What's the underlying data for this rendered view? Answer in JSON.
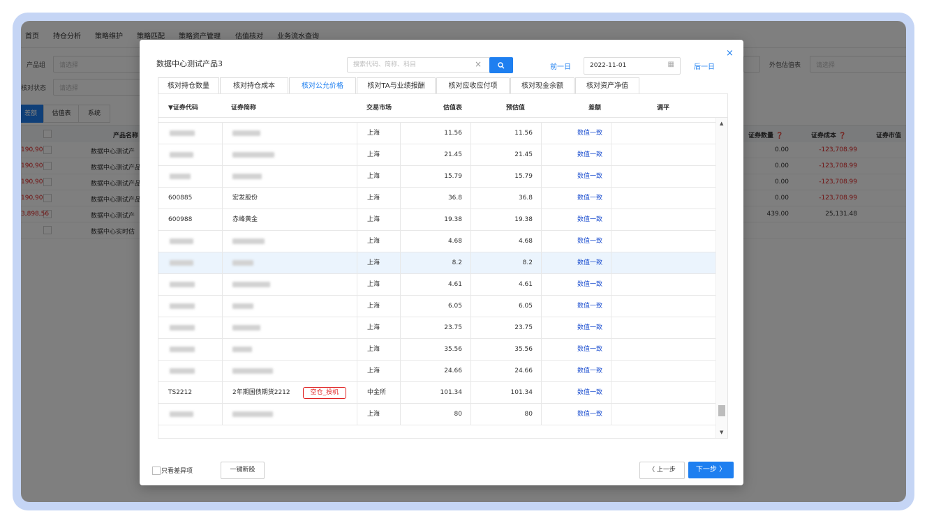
{
  "nav": {
    "items": [
      "首页",
      "持仓分析",
      "策略维护",
      "策略匹配",
      "策略资产管理",
      "估值核对",
      "业务流水查询"
    ],
    "active_index": 5
  },
  "filters": {
    "product_group_label": "产品组",
    "product_group_placeholder": "请选择",
    "check_status_label": "核对状态",
    "check_status_placeholder": "请选择",
    "outsource_label": "外包估值表",
    "outsource_placeholder": "请选择"
  },
  "subtabs": [
    "差额",
    "估值表",
    "系统"
  ],
  "bg_table": {
    "headers": {
      "product_name": "产品名称",
      "sec_qty": "证券数量 ❓",
      "sec_cost": "证券成本 ❓",
      "sec_mv": "证券市值"
    },
    "rows": [
      {
        "name": "数据中心测试产",
        "qty": "0.00",
        "cost": "-123,708.99",
        "mv": "190,90"
      },
      {
        "name": "数据中心测试产品",
        "qty": "0.00",
        "cost": "-123,708.99",
        "mv": "190,90"
      },
      {
        "name": "数据中心测试产品",
        "qty": "0.00",
        "cost": "-123,708.99",
        "mv": "190,90"
      },
      {
        "name": "数据中心测试产品",
        "qty": "0.00",
        "cost": "-123,708.99",
        "mv": "190,90"
      },
      {
        "name": "数据中心测试产",
        "qty": "439.00",
        "cost": "25,131.48",
        "mv": "3,898,56"
      },
      {
        "name": "数据中心实时估",
        "qty": "",
        "cost": "",
        "mv": ""
      }
    ]
  },
  "modal": {
    "title": "数据中心测试产品3",
    "close_label": "×",
    "search_placeholder": "搜索代码、简称、科目",
    "search_value": "",
    "prev_day": "前一日",
    "next_day": "后一日",
    "date": "2022-11-01",
    "tabs": [
      "核对持仓数量",
      "核对持仓成本",
      "核对公允价格",
      "核对TA与业绩报酬",
      "核对应收应付项",
      "核对现金余额",
      "核对资产净值"
    ],
    "active_tab": 2,
    "columns": {
      "code": "▼证券代码",
      "name": "证券简称",
      "market": "交易市场",
      "valuation": "估值表",
      "pre_valuation": "预估值",
      "diff": "差额",
      "adjust": "调平"
    },
    "rows": [
      {
        "code": "",
        "name": "",
        "tag": "",
        "market": "上海",
        "val": "11.56",
        "pre": "11.56",
        "diff": "数值一致"
      },
      {
        "code": "",
        "name": "",
        "tag": "",
        "market": "上海",
        "val": "21.45",
        "pre": "21.45",
        "diff": "数值一致"
      },
      {
        "code": "",
        "name": "",
        "tag": "",
        "market": "上海",
        "val": "15.79",
        "pre": "15.79",
        "diff": "数值一致"
      },
      {
        "code": "600885",
        "name": "宏发股份",
        "tag": "",
        "market": "上海",
        "val": "36.8",
        "pre": "36.8",
        "diff": "数值一致"
      },
      {
        "code": "600988",
        "name": "赤峰黄金",
        "tag": "",
        "market": "上海",
        "val": "19.38",
        "pre": "19.38",
        "diff": "数值一致"
      },
      {
        "code": "",
        "name": "",
        "tag": "",
        "market": "上海",
        "val": "4.68",
        "pre": "4.68",
        "diff": "数值一致"
      },
      {
        "code": "",
        "name": "",
        "tag": "",
        "market": "上海",
        "val": "8.2",
        "pre": "8.2",
        "diff": "数值一致"
      },
      {
        "code": "",
        "name": "",
        "tag": "",
        "market": "上海",
        "val": "4.61",
        "pre": "4.61",
        "diff": "数值一致"
      },
      {
        "code": "",
        "name": "",
        "tag": "",
        "market": "上海",
        "val": "6.05",
        "pre": "6.05",
        "diff": "数值一致"
      },
      {
        "code": "",
        "name": "",
        "tag": "",
        "market": "上海",
        "val": "23.75",
        "pre": "23.75",
        "diff": "数值一致"
      },
      {
        "code": "",
        "name": "",
        "tag": "",
        "market": "上海",
        "val": "35.56",
        "pre": "35.56",
        "diff": "数值一致"
      },
      {
        "code": "",
        "name": "",
        "tag": "",
        "market": "上海",
        "val": "24.66",
        "pre": "24.66",
        "diff": "数值一致"
      },
      {
        "code": "TS2212",
        "name": "2年期国债期货2212",
        "tag": "空仓_投机",
        "market": "中金所",
        "val": "101.34",
        "pre": "101.34",
        "diff": "数值一致"
      },
      {
        "code": "",
        "name": "",
        "tag": "",
        "market": "上海",
        "val": "80",
        "pre": "80",
        "diff": "数值一致"
      }
    ],
    "highlight_row": 6,
    "only_diff_label": "只看差异项",
    "new_stock_button": "一键新股",
    "prev_step": "〈 上一步",
    "next_step": "下一步 〉"
  },
  "colors": {
    "accent": "#1e7ff0",
    "negative": "#e02020",
    "diff_text": "#1e50d0",
    "highlight_row": "#ebf4fd"
  },
  "icons": [
    "search-icon",
    "close-icon",
    "clear-icon",
    "calendar-icon",
    "sort-desc-icon",
    "scroll-up-icon",
    "scroll-down-icon"
  ]
}
